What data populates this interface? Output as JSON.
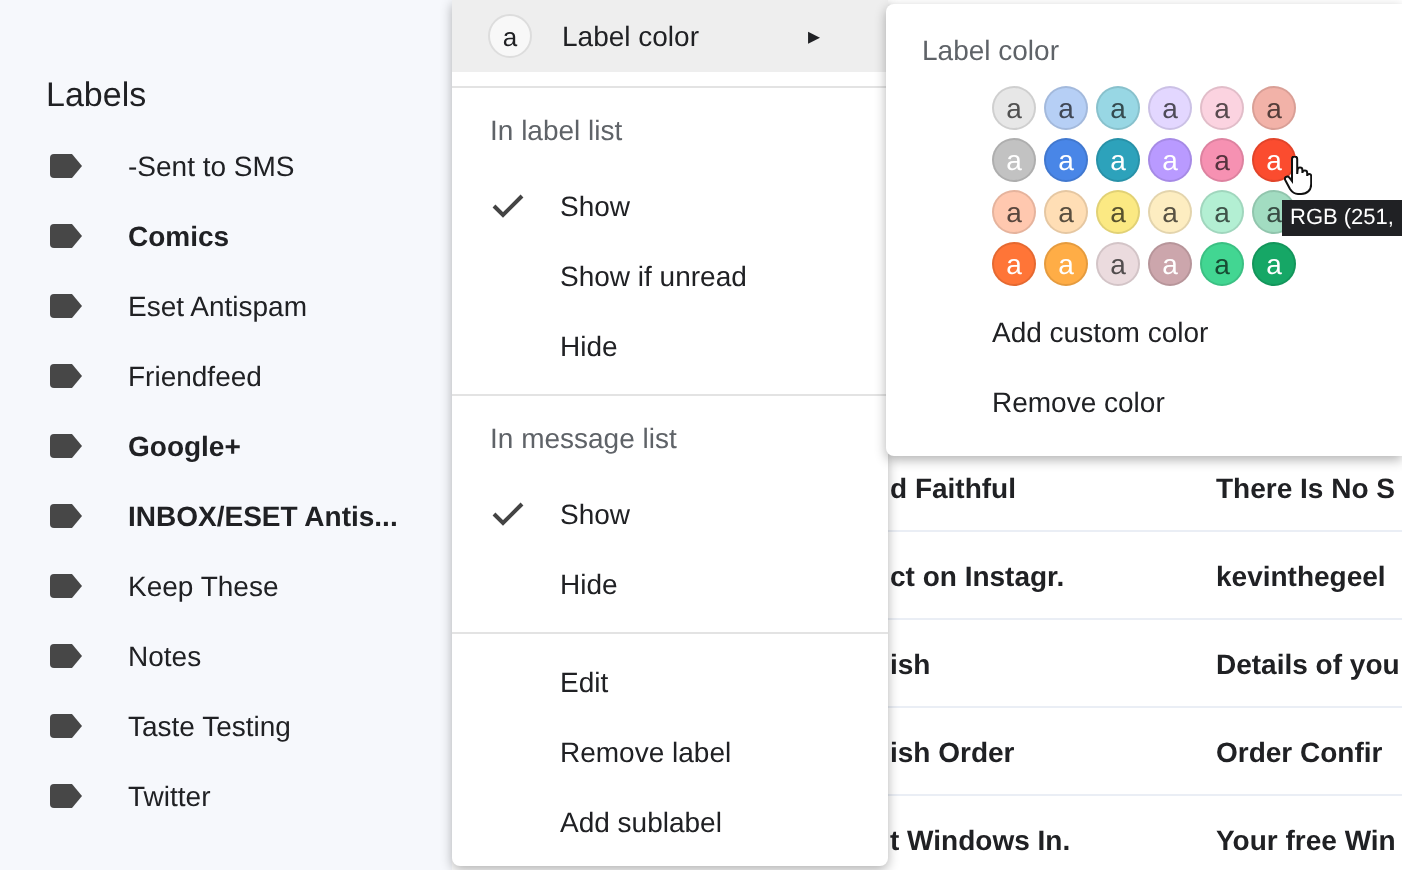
{
  "sidebar": {
    "heading": "Labels",
    "labels": [
      {
        "name": "-Sent to SMS",
        "bold": false
      },
      {
        "name": "Comics",
        "bold": true
      },
      {
        "name": "Eset Antispam",
        "bold": false
      },
      {
        "name": "Friendfeed",
        "bold": false
      },
      {
        "name": "Google+",
        "bold": true
      },
      {
        "name": "INBOX/ESET Antis...",
        "bold": true
      },
      {
        "name": "Keep These",
        "bold": false
      },
      {
        "name": "Notes",
        "bold": false
      },
      {
        "name": "Taste Testing",
        "bold": false
      },
      {
        "name": "Twitter",
        "bold": false
      }
    ]
  },
  "messages": [
    {
      "column_1": "d Faithful",
      "column_2": "There Is No S"
    },
    {
      "column_1": "ct on Instagr.",
      "column_2": "kevinthegeel"
    },
    {
      "column_1": "ish",
      "column_2": "Details of you"
    },
    {
      "column_1": "ish Order",
      "column_2": "Order Confir"
    },
    {
      "column_1": "t Windows In.",
      "column_2": "Your free Win"
    }
  ],
  "menu": {
    "label_color": {
      "swatch": "a",
      "label": "Label color",
      "arrow": "▸"
    },
    "sections": [
      {
        "heading": "In label list",
        "items": [
          {
            "label": "Show",
            "checked": true
          },
          {
            "label": "Show if unread",
            "checked": false
          },
          {
            "label": "Hide",
            "checked": false
          }
        ]
      },
      {
        "heading": "In message list",
        "items": [
          {
            "label": "Show",
            "checked": true
          },
          {
            "label": "Hide",
            "checked": false
          }
        ]
      },
      {
        "items": [
          {
            "label": "Edit",
            "checked": false
          },
          {
            "label": "Remove label",
            "checked": false
          },
          {
            "label": "Add sublabel",
            "checked": false
          }
        ]
      }
    ]
  },
  "submenu": {
    "title": "Label color",
    "swatches": [
      {
        "label": "a",
        "color": "#e7e7e7",
        "kind": "dark"
      },
      {
        "label": "a",
        "color": "#b6cff5",
        "kind": "dark"
      },
      {
        "label": "a",
        "color": "#98d7e4",
        "kind": "dark"
      },
      {
        "label": "a",
        "color": "#e3d7ff",
        "kind": "dark"
      },
      {
        "label": "a",
        "color": "#fbd3e0",
        "kind": "dark"
      },
      {
        "label": "a",
        "color": "#f2b2a8",
        "kind": "dark"
      },
      {
        "label": "a",
        "color": "#c2c2c2",
        "kind": "light"
      },
      {
        "label": "a",
        "color": "#4986e7",
        "kind": "light"
      },
      {
        "label": "a",
        "color": "#2da2bb",
        "kind": "light"
      },
      {
        "label": "a",
        "color": "#b99aff",
        "kind": "light"
      },
      {
        "label": "a",
        "color": "#f691b2",
        "kind": "dark"
      },
      {
        "label": "a",
        "color": "#fb4c2f",
        "kind": "light"
      },
      {
        "label": "a",
        "color": "#ffc8af",
        "kind": "dark"
      },
      {
        "label": "a",
        "color": "#ffdeb5",
        "kind": "dark"
      },
      {
        "label": "a",
        "color": "#fbe983",
        "kind": "dark"
      },
      {
        "label": "a",
        "color": "#fdedc1",
        "kind": "dark"
      },
      {
        "label": "a",
        "color": "#b3efd3",
        "kind": "dark"
      },
      {
        "label": "a",
        "color": "#a2dcc1",
        "kind": "dark"
      },
      {
        "label": "a",
        "color": "#ff7537",
        "kind": "light"
      },
      {
        "label": "a",
        "color": "#ffad46",
        "kind": "light"
      },
      {
        "label": "a",
        "color": "#ebdbde",
        "kind": "dark"
      },
      {
        "label": "a",
        "color": "#cca6ac",
        "kind": "light"
      },
      {
        "label": "a",
        "color": "#42d692",
        "kind": "dark"
      },
      {
        "label": "a",
        "color": "#16a766",
        "kind": "light"
      }
    ],
    "tooltip": "RGB (251,",
    "actions": [
      "Add custom color",
      "Remove color"
    ]
  }
}
